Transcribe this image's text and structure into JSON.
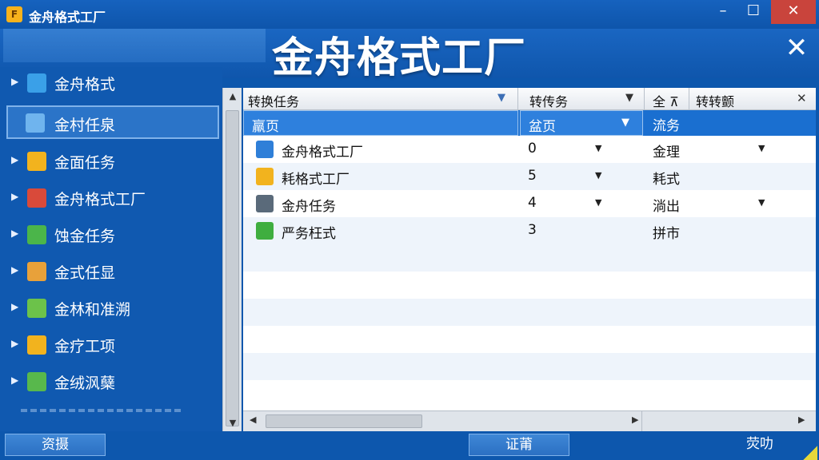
{
  "window": {
    "title": "金舟格式工厂",
    "app_icon_glyph": "F",
    "minimize_glyph": "–",
    "maximize_glyph": "☐",
    "close_glyph": "✕"
  },
  "banner": {
    "title": "金舟格式工厂",
    "close_glyph": "✕"
  },
  "sidebar": {
    "items": [
      {
        "label": "金舟格式",
        "icon": "puzzle-icon",
        "icon_color": "#3aa0e8",
        "expandable": true,
        "selected": false
      },
      {
        "label": "金村任泉",
        "icon": "grid-icon",
        "icon_color": "#6fb4ee",
        "expandable": false,
        "selected": true
      },
      {
        "label": "金面任务",
        "icon": "folder-icon",
        "icon_color": "#f2b31e",
        "expandable": true,
        "selected": false
      },
      {
        "label": "金舟格式工厂",
        "icon": "tool-icon",
        "icon_color": "#d94a3a",
        "expandable": true,
        "selected": false
      },
      {
        "label": "蚀金任务",
        "icon": "globe-user-icon",
        "icon_color": "#4bb54a",
        "expandable": true,
        "selected": false
      },
      {
        "label": "金式任显",
        "icon": "calendar-icon",
        "icon_color": "#e8a13a",
        "expandable": true,
        "selected": false
      },
      {
        "label": "金林和准溯",
        "icon": "media-icon",
        "icon_color": "#6cc24a",
        "expandable": true,
        "selected": false
      },
      {
        "label": "金疗工项",
        "icon": "arrow-icon",
        "icon_color": "#f2b31e",
        "expandable": true,
        "selected": false
      },
      {
        "label": "金绒沨蘖",
        "icon": "monitor-icon",
        "icon_color": "#58b84c",
        "expandable": true,
        "selected": false
      }
    ],
    "expand_glyph": "▶"
  },
  "scroll": {
    "up_glyph": "▲",
    "down_glyph": "▼",
    "left_glyph": "◀",
    "right_glyph": "▶"
  },
  "grid": {
    "columns": [
      {
        "label": "转换任务",
        "dropdown": "▼"
      },
      {
        "label": "转传务",
        "dropdown": "▼"
      },
      {
        "label": "全 ⊼",
        "dropdown": ""
      },
      {
        "label": "转转颤",
        "dropdown": "✕"
      }
    ],
    "filter": [
      {
        "label": "羸页"
      },
      {
        "label": "盆页",
        "dropdown": "▼"
      },
      {
        "label": "流务"
      }
    ],
    "rows": [
      {
        "name": "金舟格式工厂",
        "icon": "image-icon",
        "icon_color": "#2f7fd8",
        "count": "0",
        "status": "金理",
        "has_dd1": true,
        "has_dd2": true
      },
      {
        "name": "耗格式工厂",
        "icon": "document-icon",
        "icon_color": "#f2b31e",
        "count": "5",
        "status": "耗式",
        "has_dd1": true,
        "has_dd2": false
      },
      {
        "name": "金舟任务",
        "icon": "monitor-icon",
        "icon_color": "#5a6a7a",
        "count": "4",
        "status": "淌出",
        "has_dd1": true,
        "has_dd2": true
      },
      {
        "name": "严务枉式",
        "icon": "info-icon",
        "icon_color": "#3fae3f",
        "count": "3",
        "status": "拼市",
        "has_dd1": false,
        "has_dd2": false
      }
    ],
    "row_dropdown_glyph": "▼"
  },
  "bottom": {
    "left_button": "资摄",
    "middle_button": "证莆",
    "right_button": "荧叻"
  }
}
